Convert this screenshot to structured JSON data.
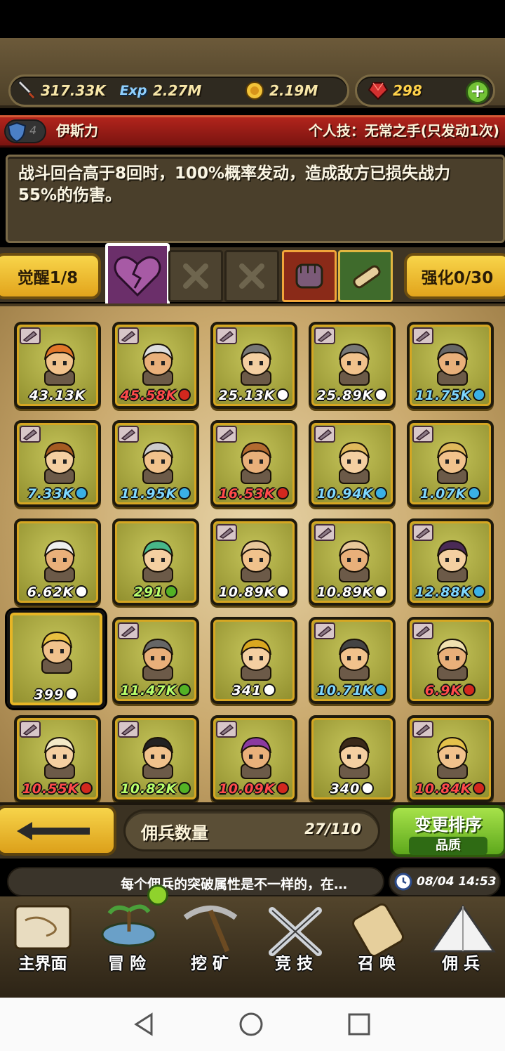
{
  "resources": {
    "power": "317.33K",
    "exp": "2.27M",
    "gold": "2.19M",
    "gems": "298",
    "add_label": "+"
  },
  "hero": {
    "rank": "4",
    "name": "伊斯力",
    "skill_label": "个人技：无常之手(只发动1次)",
    "description": "战斗回合高于8回时，100%概率发动，造成敌方已损失战力55%的伤害。"
  },
  "actions": {
    "awaken": "觉醒1/8",
    "enhance": "强化0/30"
  },
  "mercenaries": [
    {
      "value": "43.13K",
      "badge": "none",
      "color": "#ffffff",
      "tag": true
    },
    {
      "value": "45.58K",
      "badge": "red",
      "color": "#ff4a4a",
      "tag": true
    },
    {
      "value": "25.13K",
      "badge": "white",
      "color": "#ffffff",
      "tag": true
    },
    {
      "value": "25.89K",
      "badge": "white",
      "color": "#ffffff",
      "tag": true
    },
    {
      "value": "11.75K",
      "badge": "blue",
      "color": "#7fd8ff",
      "tag": true
    },
    {
      "value": "7.33K",
      "badge": "blue",
      "color": "#7fd8ff",
      "tag": true
    },
    {
      "value": "11.95K",
      "badge": "blue",
      "color": "#7fd8ff",
      "tag": true
    },
    {
      "value": "16.53K",
      "badge": "red",
      "color": "#ff4a4a",
      "tag": true
    },
    {
      "value": "10.94K",
      "badge": "blue",
      "color": "#7fd8ff",
      "tag": true
    },
    {
      "value": "1.07K",
      "badge": "blue",
      "color": "#7fd8ff",
      "tag": true
    },
    {
      "value": "6.62K",
      "badge": "white",
      "color": "#ffffff",
      "tag": false
    },
    {
      "value": "291",
      "badge": "green",
      "color": "#b8ff6a",
      "tag": false
    },
    {
      "value": "10.89K",
      "badge": "white",
      "color": "#ffffff",
      "tag": true
    },
    {
      "value": "10.89K",
      "badge": "white",
      "color": "#ffffff",
      "tag": true
    },
    {
      "value": "12.88K",
      "badge": "blue",
      "color": "#7fd8ff",
      "tag": true
    },
    {
      "value": "399",
      "badge": "white",
      "color": "#ffffff",
      "tag": false
    },
    {
      "value": "11.47K",
      "badge": "green",
      "color": "#b8ff6a",
      "tag": true
    },
    {
      "value": "341",
      "badge": "white",
      "color": "#ffffff",
      "tag": false
    },
    {
      "value": "10.71K",
      "badge": "blue",
      "color": "#7fd8ff",
      "tag": true
    },
    {
      "value": "6.9K",
      "badge": "red",
      "color": "#ff4a4a",
      "tag": true
    },
    {
      "value": "10.55K",
      "badge": "red",
      "color": "#ff4a4a",
      "tag": true
    },
    {
      "value": "10.82K",
      "badge": "green",
      "color": "#b8ff6a",
      "tag": true
    },
    {
      "value": "10.09K",
      "badge": "red",
      "color": "#ff4a4a",
      "tag": true
    },
    {
      "value": "340",
      "badge": "white",
      "color": "#ffffff",
      "tag": false
    },
    {
      "value": "10.84K",
      "badge": "red",
      "color": "#ff4a4a",
      "tag": true
    }
  ],
  "footer": {
    "count_label": "佣兵数量",
    "count_value": "27/110",
    "sort_label": "变更排序",
    "sort_sub": "品质",
    "ticker": "每个佣兵的突破属性是不一样的，在…",
    "time": "08/04 14:53"
  },
  "nav": [
    "主界面",
    "冒 险",
    "挖 矿",
    "竞 技",
    "召 唤",
    "佣 兵"
  ]
}
